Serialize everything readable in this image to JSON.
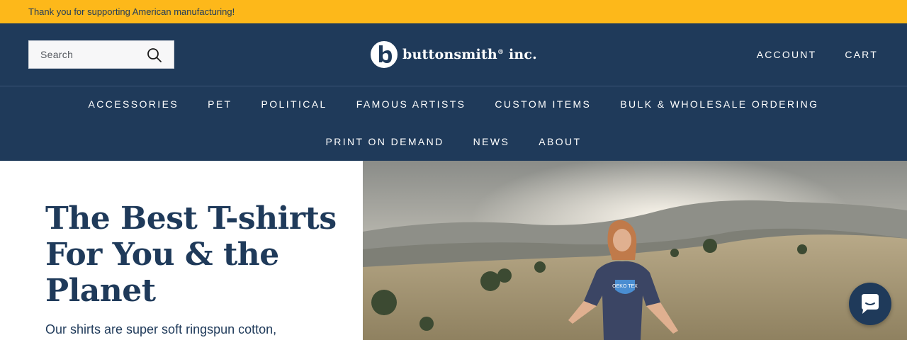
{
  "announcement": {
    "text": "Thank you for supporting American manufacturing!"
  },
  "header": {
    "search": {
      "placeholder": "Search"
    },
    "brand": {
      "name": "buttonsmith",
      "reg": "®",
      "suffix": " inc."
    },
    "links": [
      "ACCOUNT",
      "CART"
    ]
  },
  "nav": {
    "row1": [
      "ACCESSORIES",
      "PET",
      "POLITICAL",
      "FAMOUS ARTISTS",
      "CUSTOM ITEMS",
      "BULK & WHOLESALE ORDERING"
    ],
    "row2": [
      "PRINT ON DEMAND",
      "NEWS",
      "ABOUT"
    ]
  },
  "hero": {
    "title": "The Best T-shirts For You & the Planet",
    "copy": "Our shirts are super soft ringspun cotton,",
    "shirt_text": "OEKO TEX"
  },
  "colors": {
    "navy": "#1f3a5a",
    "gold": "#fdb81a",
    "white": "#ffffff"
  }
}
